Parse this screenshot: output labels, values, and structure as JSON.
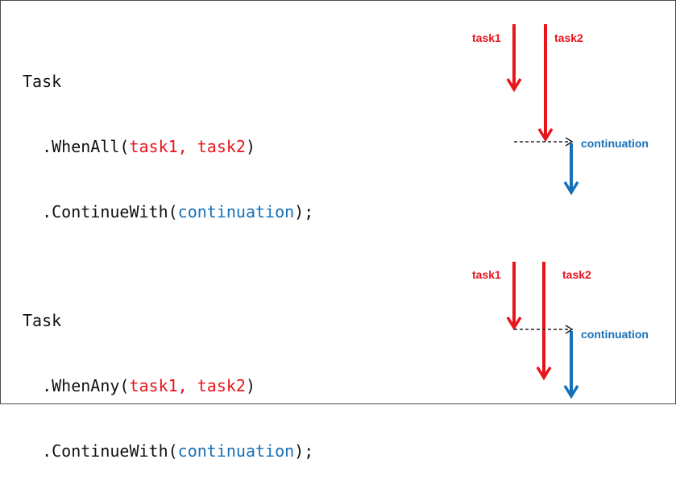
{
  "colors": {
    "task": "#e8141b",
    "continuation": "#1770b8",
    "code_text": "#111111",
    "dashed": "#222222"
  },
  "examples": [
    {
      "code": {
        "line1": "Task",
        "line2_prefix": "  .WhenAll(",
        "line2_args": "task1, task2",
        "line2_suffix": ")",
        "line3_prefix": "  .ContinueWith(",
        "line3_arg": "continuation",
        "line3_suffix": ");"
      },
      "diagram": {
        "task1_label": "task1",
        "task2_label": "task2",
        "continuation_label": "continuation"
      }
    },
    {
      "code": {
        "line1": "Task",
        "line2_prefix": "  .WhenAny(",
        "line2_args": "task1, task2",
        "line2_suffix": ")",
        "line3_prefix": "  .ContinueWith(",
        "line3_arg": "continuation",
        "line3_suffix": ");"
      },
      "diagram": {
        "task1_label": "task1",
        "task2_label": "task2",
        "continuation_label": "continuation"
      }
    }
  ]
}
